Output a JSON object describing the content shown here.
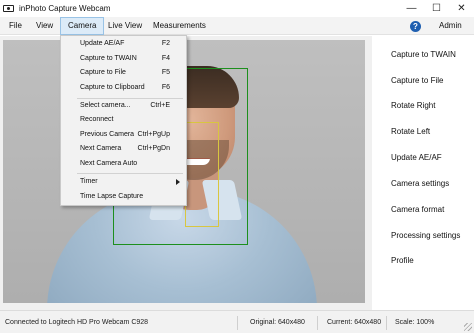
{
  "window": {
    "title": "inPhoto Capture Webcam",
    "minimize": "—",
    "maximize": "☐",
    "close": "✕"
  },
  "menubar": {
    "items": [
      {
        "label": "File"
      },
      {
        "label": "View"
      },
      {
        "label": "Camera"
      },
      {
        "label": "Live View"
      },
      {
        "label": "Measurements"
      }
    ],
    "help_glyph": "?",
    "admin_label": "Admin"
  },
  "camera_menu": {
    "items": [
      {
        "label": "Update AE/AF",
        "shortcut": "F2"
      },
      {
        "label": "Capture to TWAIN",
        "shortcut": "F4"
      },
      {
        "label": "Capture to File",
        "shortcut": "F5"
      },
      {
        "label": "Capture to Clipboard",
        "shortcut": "F6"
      },
      {
        "label": "Select camera...",
        "shortcut": "Ctrl+E"
      },
      {
        "label": "Reconnect",
        "shortcut": ""
      },
      {
        "label": "Previous Camera",
        "shortcut": "Ctrl+PgUp"
      },
      {
        "label": "Next Camera",
        "shortcut": "Ctrl+PgDn"
      },
      {
        "label": "Next Camera Auto",
        "shortcut": ""
      },
      {
        "label": "Timer",
        "shortcut": ""
      },
      {
        "label": "Time Lapse Capture",
        "shortcut": ""
      }
    ]
  },
  "side_panel": {
    "items": [
      {
        "label": "Capture to TWAIN"
      },
      {
        "label": "Capture to File"
      },
      {
        "label": "Rotate Right"
      },
      {
        "label": "Rotate Left"
      },
      {
        "label": "Update AE/AF"
      },
      {
        "label": "Camera settings"
      },
      {
        "label": "Camera format"
      },
      {
        "label": "Processing settings"
      },
      {
        "label": "Profile"
      }
    ]
  },
  "status": {
    "connection": "Connected to Logitech HD Pro Webcam C928",
    "original": "Original: 640x480",
    "current": "Current: 640x480",
    "scale": "Scale: 100%"
  },
  "colors": {
    "face_box": "#1d8f1d",
    "eye_box": "#d8c640",
    "menu_highlight": "#dcebf8",
    "help_icon": "#1f5fb0"
  }
}
